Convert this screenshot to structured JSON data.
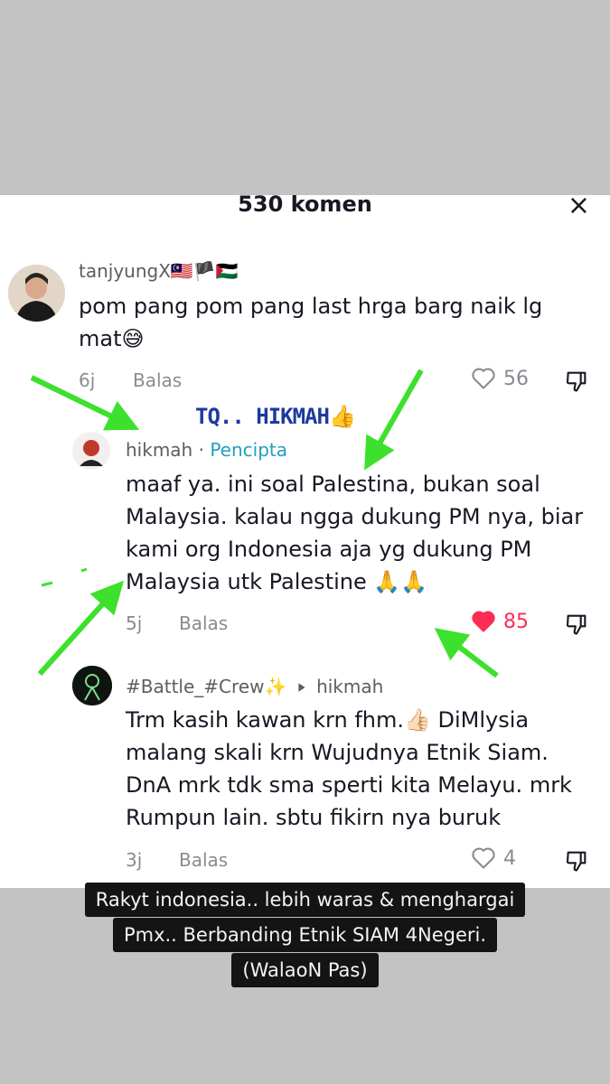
{
  "header": {
    "title": "530 komen",
    "close_symbol": "×"
  },
  "comments": [
    {
      "username": "tanjyungX🇲🇾🏴🇵🇸",
      "lines": [
        "pom pang pom pang last hrga barg naik lg",
        "mat😅"
      ],
      "time": "6j",
      "reply_label": "Balas",
      "likes": "56",
      "liked": false
    },
    {
      "username": "hikmah",
      "separator": " · ",
      "badge": "Pencipta",
      "lines": [
        "maaf ya. ini soal Palestina, bukan soal",
        "Malaysia. kalau ngga dukung PM nya, biar",
        "kami org Indonesia aja yg dukung PM",
        "Malaysia utk Palestine 🙏🙏"
      ],
      "time": "5j",
      "reply_label": "Balas",
      "likes": "85",
      "liked": true
    },
    {
      "username": "#Battle_#Crew✨",
      "reply_to": "hikmah",
      "lines": [
        "Trm kasih kawan krn fhm.👍🏻 DiMlysia",
        "malang skali krn Wujudnya Etnik Siam.",
        "DnA mrk tdk sma sperti kita Melayu. mrk",
        "Rumpun lain. sbtu fikirn nya buruk"
      ],
      "time": "3j",
      "reply_label": "Balas",
      "likes": "4",
      "liked": false
    }
  ],
  "overlay": {
    "label": "TQ.. HIKMAH👍",
    "caption_lines": [
      "Rakyt indonesia.. lebih waras & menghargai",
      "Pmx.. Berbanding Etnik SIAM 4Negeri.",
      "(WalaoN Pas)"
    ]
  },
  "colors": {
    "arrow": "#3ee02e",
    "like_active": "#fe2c55",
    "badge": "#20a0c0",
    "label": "#1d3a9e"
  }
}
